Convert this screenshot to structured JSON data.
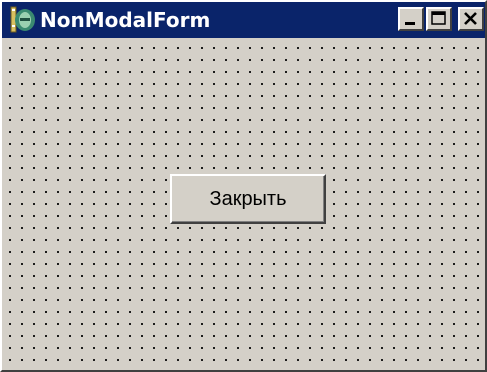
{
  "window": {
    "title": "NonModalForm",
    "app_icon": "delphi-helmet-icon"
  },
  "caption_buttons": {
    "minimize": "minimize-icon",
    "maximize": "maximize-icon",
    "close": "close-icon"
  },
  "form": {
    "close_button_label": "Закрыть"
  },
  "colors": {
    "title_bar": "#0a246a",
    "title_text": "#ffffff",
    "face": "#d4d0c8",
    "grid_dots": "#000000"
  }
}
